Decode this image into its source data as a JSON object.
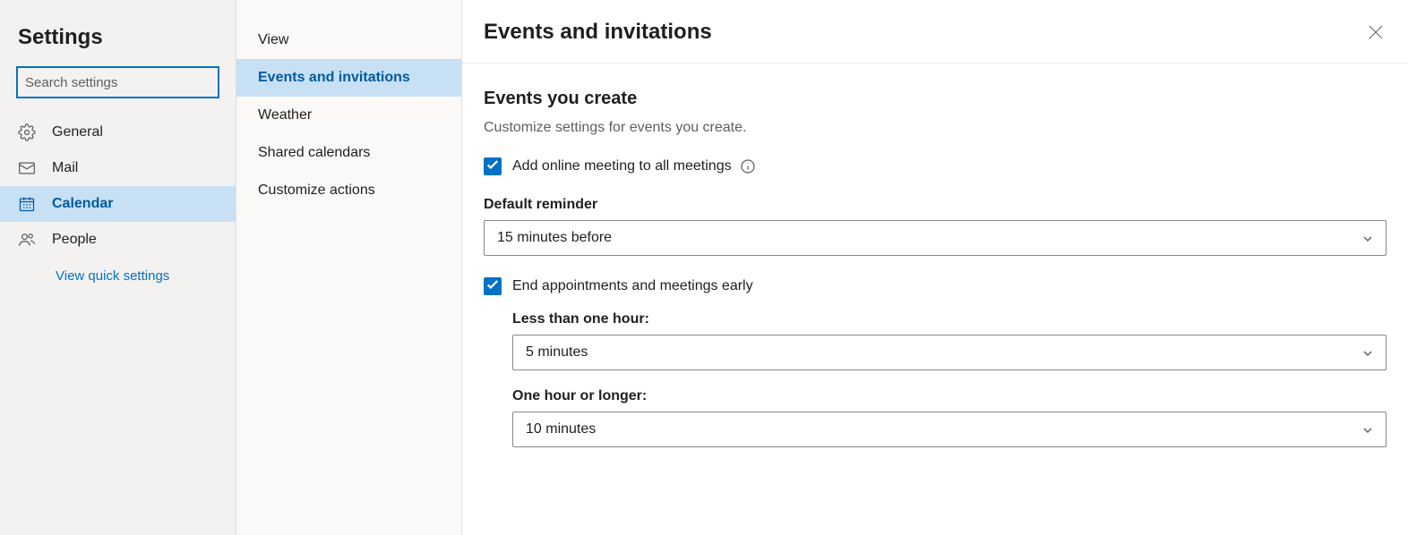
{
  "sidebar": {
    "title": "Settings",
    "search_placeholder": "Search settings",
    "items": [
      {
        "label": "General"
      },
      {
        "label": "Mail"
      },
      {
        "label": "Calendar"
      },
      {
        "label": "People"
      }
    ],
    "quick_settings": "View quick settings"
  },
  "subnav": {
    "items": [
      {
        "label": "View"
      },
      {
        "label": "Events and invitations"
      },
      {
        "label": "Weather"
      },
      {
        "label": "Shared calendars"
      },
      {
        "label": "Customize actions"
      }
    ]
  },
  "main": {
    "title": "Events and invitations",
    "section_title": "Events you create",
    "section_subtitle": "Customize settings for events you create.",
    "add_online_meeting_label": "Add online meeting to all meetings",
    "default_reminder_label": "Default reminder",
    "default_reminder_value": "15 minutes before",
    "end_early_label": "End appointments and meetings early",
    "less_than_hour_label": "Less than one hour:",
    "less_than_hour_value": "5 minutes",
    "hour_or_longer_label": "One hour or longer:",
    "hour_or_longer_value": "10 minutes"
  }
}
